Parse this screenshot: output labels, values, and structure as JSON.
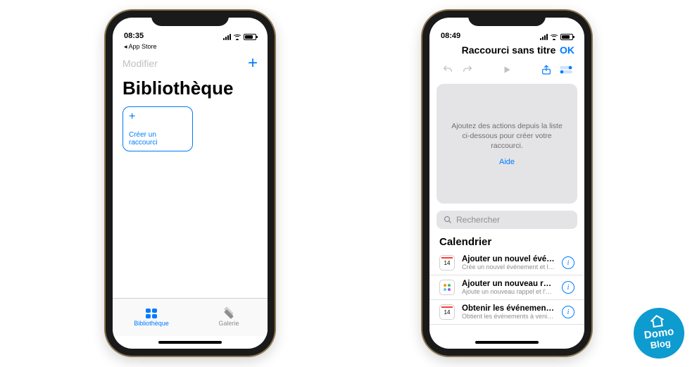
{
  "colors": {
    "accent": "#007aff",
    "muted": "#8e8e93",
    "canvas": "#e4e4e6"
  },
  "left": {
    "status_time": "08:35",
    "back_app": "◂ App Store",
    "modifier": "Modifier",
    "title": "Bibliothèque",
    "create_label": "Créer un raccourci",
    "tabs": {
      "library": "Bibliothèque",
      "gallery": "Galerie"
    }
  },
  "right": {
    "status_time": "08:49",
    "header_title": "Raccourci sans titre",
    "ok": "OK",
    "empty_text": "Ajoutez des actions depuis la liste ci-dessous pour créer votre raccourci.",
    "help": "Aide",
    "search_placeholder": "Rechercher",
    "section_title": "Calendrier",
    "actions": [
      {
        "icon": "calendar",
        "day": "14",
        "title": "Ajouter un nouvel événement",
        "sub": "Crée un nouvel événement et l'ajoute au ca..."
      },
      {
        "icon": "reminders",
        "title": "Ajouter un nouveau rappel",
        "sub": "Ajoute un nouveau rappel et l'ajoute à la liste..."
      },
      {
        "icon": "calendar",
        "day": "14",
        "title": "Obtenir les événements à venir",
        "sub": "Obtient les événements à venir du calendri..."
      }
    ]
  },
  "logo": {
    "line1": "Domo",
    "line2": "Blog"
  }
}
